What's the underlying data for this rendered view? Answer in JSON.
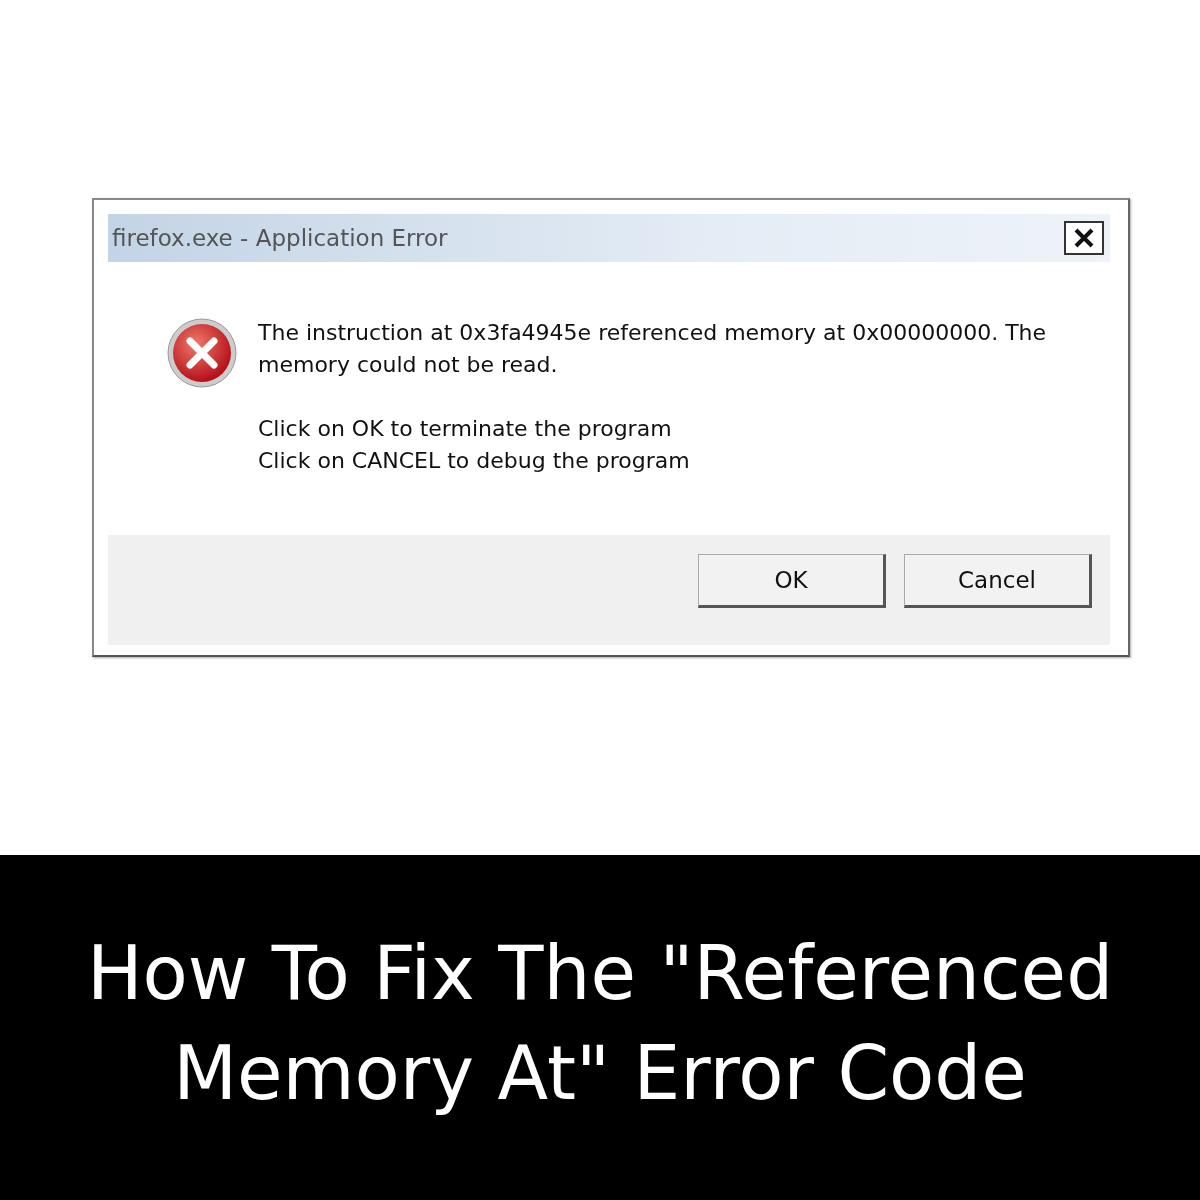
{
  "dialog": {
    "title": "firefox.exe - Application Error",
    "message": [
      "The instruction at 0x3fa4945e referenced memory at 0x00000000. The memory could not be read.",
      "Click on OK to terminate the program\nClick on CANCEL to debug the program"
    ],
    "buttons": [
      {
        "label": "OK"
      },
      {
        "label": "Cancel"
      }
    ]
  },
  "caption": {
    "lines": [
      "How To Fix The \"Referenced",
      "Memory At\" Error Code"
    ]
  }
}
